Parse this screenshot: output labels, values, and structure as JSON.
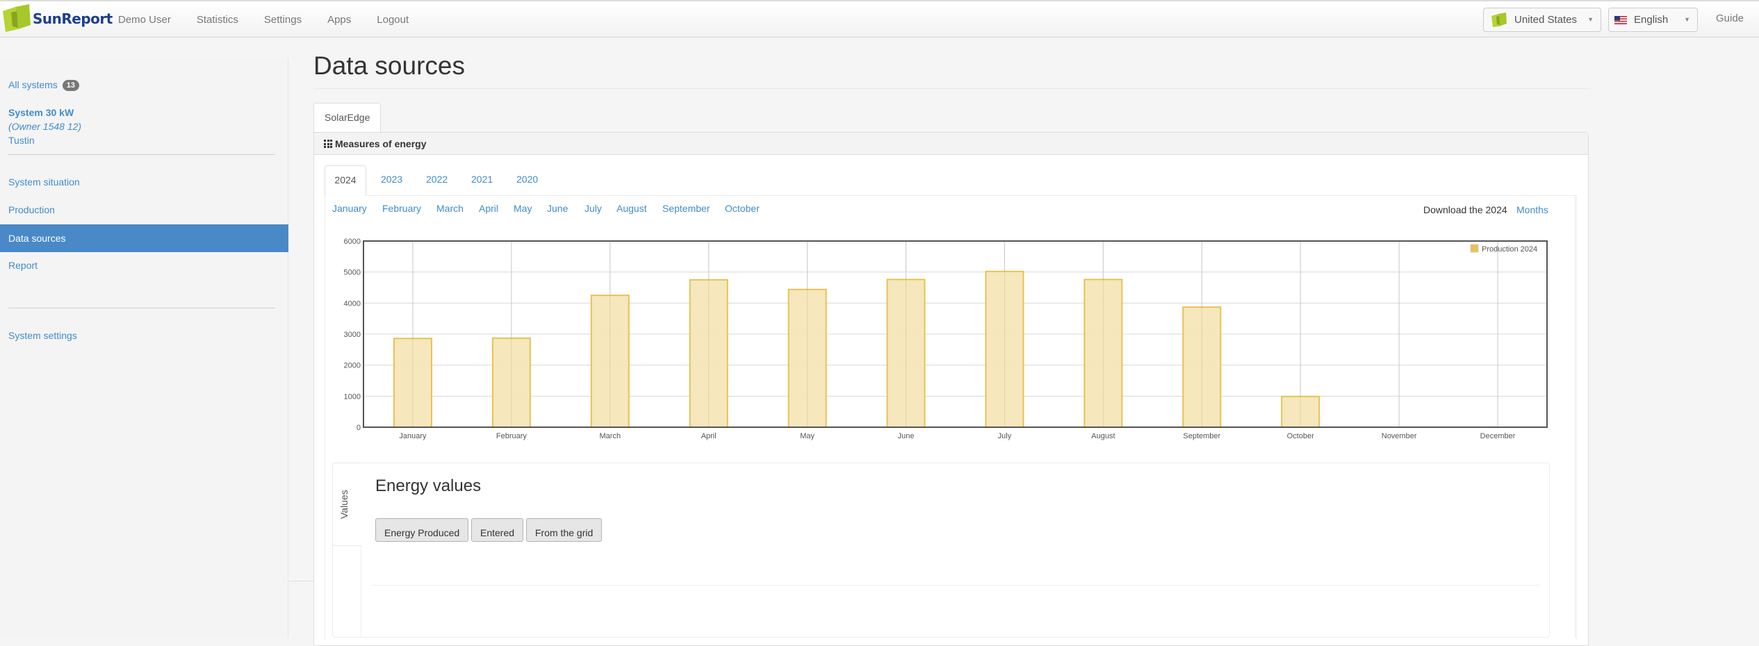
{
  "navbar": {
    "brand": "SunReport",
    "links": [
      "Demo User",
      "Statistics",
      "Settings",
      "Apps",
      "Logout"
    ],
    "country_select": "United States",
    "language_select": "English",
    "guide": "Guide"
  },
  "sidebar": {
    "all_systems_label": "All systems",
    "all_systems_count": "13",
    "system_name": "System 30 kW",
    "system_owner": "(Owner 1548 12)",
    "system_city": "Tustin",
    "items": [
      {
        "label": "System situation",
        "active": false
      },
      {
        "label": "Production",
        "active": false
      },
      {
        "label": "Data sources",
        "active": true
      },
      {
        "label": "Report",
        "active": false
      }
    ],
    "settings_label": "System settings"
  },
  "main": {
    "title": "Data sources",
    "source_tab": "SolarEdge",
    "panel_title": "Measures of energy",
    "year_tabs": [
      "2024",
      "2023",
      "2022",
      "2021",
      "2020"
    ],
    "active_year": "2024",
    "month_links": [
      "January",
      "February",
      "March",
      "April",
      "May",
      "June",
      "July",
      "August",
      "September",
      "October"
    ],
    "download_label": "Download the 2024",
    "download_link": "Months",
    "values": {
      "side_tab": "Values",
      "title": "Energy values",
      "buttons": [
        "Energy Produced",
        "Entered",
        "From the grid"
      ]
    }
  },
  "colors": {
    "accent": "#428bca",
    "active_sidebar": "#4a89c8",
    "bar_fill": "#f5e6b8",
    "bar_stroke": "#e8c252"
  },
  "chart_data": {
    "type": "bar",
    "title": "",
    "xlabel": "",
    "ylabel": "",
    "categories": [
      "January",
      "February",
      "March",
      "April",
      "May",
      "June",
      "July",
      "August",
      "September",
      "October",
      "November",
      "December"
    ],
    "series": [
      {
        "name": "Production 2024",
        "values": [
          2860,
          2870,
          4250,
          4750,
          4440,
          4760,
          5020,
          4760,
          3870,
          990,
          null,
          null
        ]
      }
    ],
    "ylim": [
      0,
      6000
    ],
    "yticks": [
      0,
      1000,
      2000,
      3000,
      4000,
      5000,
      6000
    ],
    "grid": true,
    "legend": "top-right"
  }
}
